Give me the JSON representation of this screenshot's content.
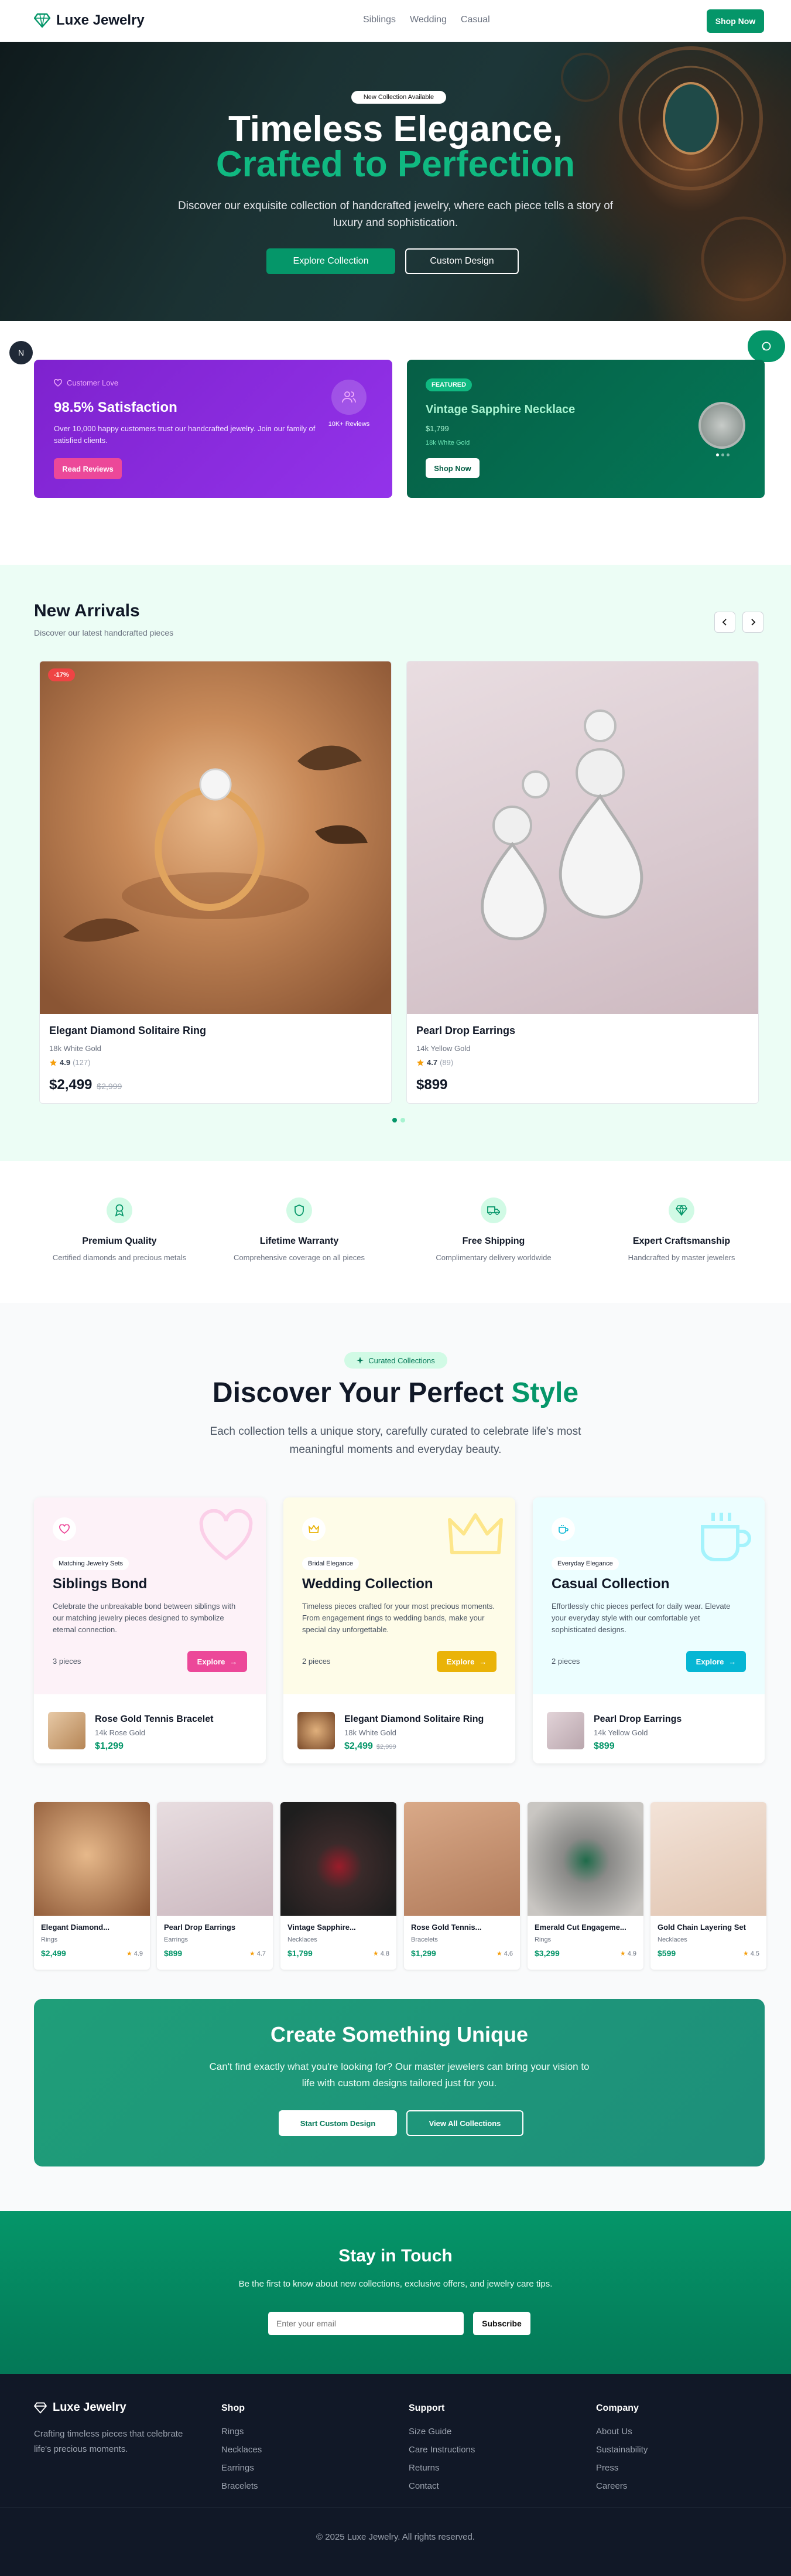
{
  "header": {
    "brand": "Luxe Jewelry",
    "nav": [
      "Siblings",
      "Wedding",
      "Casual"
    ],
    "shop_button": "Shop Now"
  },
  "hero": {
    "badge": "New Collection Available",
    "title_line1": "Timeless Elegance,",
    "title_line2": "Crafted to Perfection",
    "subtitle": "Discover our exquisite collection of handcrafted jewelry, where each piece tells a story of luxury and sophistication.",
    "primary_button": "Explore Collection",
    "secondary_button": "Custom Design"
  },
  "floating": {
    "left_avatar": "N"
  },
  "promo": {
    "left": {
      "eyebrow": "Customer Love",
      "title": "98.5% Satisfaction",
      "text": "Over 10,000 happy customers trust our handcrafted jewelry. Join our family of satisfied clients.",
      "button": "Read Reviews",
      "stat": "10K+ Reviews"
    },
    "right": {
      "badge": "FEATURED",
      "title": "Vintage Sapphire Necklace",
      "price": "$1,799",
      "material": "18k White Gold",
      "button": "Shop Now"
    }
  },
  "arrivals": {
    "title": "New Arrivals",
    "subtitle": "Discover our latest handcrafted pieces",
    "products": [
      {
        "discount": "-17%",
        "name": "Elegant Diamond Solitaire Ring",
        "material": "18k White Gold",
        "rating": "4.9",
        "reviews": "(127)",
        "price": "$2,499",
        "old_price": "$2,999"
      },
      {
        "name": "Pearl Drop Earrings",
        "material": "14k Yellow Gold",
        "rating": "4.7",
        "reviews": "(89)",
        "price": "$899"
      }
    ]
  },
  "features": [
    {
      "title": "Premium Quality",
      "desc": "Certified diamonds and precious metals"
    },
    {
      "title": "Lifetime Warranty",
      "desc": "Comprehensive coverage on all pieces"
    },
    {
      "title": "Free Shipping",
      "desc": "Complimentary delivery worldwide"
    },
    {
      "title": "Expert Craftsmanship",
      "desc": "Handcrafted by master jewelers"
    }
  ],
  "collections": {
    "badge": "Curated Collections",
    "title_a": "Discover Your Perfect",
    "title_b": "Style",
    "subtitle": "Each collection tells a unique story, carefully curated to celebrate life's most meaningful moments and everyday beauty.",
    "cards": [
      {
        "badge": "Matching Jewelry Sets",
        "title": "Siblings Bond",
        "desc": "Celebrate the unbreakable bond between siblings with our matching jewelry pieces designed to symbolize eternal connection.",
        "pieces": "3 pieces",
        "button": "Explore",
        "item": "Rose Gold Tennis Bracelet",
        "item_material": "14k Rose Gold",
        "item_price": "$1,299",
        "item_old": "",
        "color": "#ec4899"
      },
      {
        "badge": "Bridal Elegance",
        "title": "Wedding Collection",
        "desc": "Timeless pieces crafted for your most precious moments. From engagement rings to wedding bands, make your special day unforgettable.",
        "pieces": "2 pieces",
        "button": "Explore",
        "item": "Elegant Diamond Solitaire Ring",
        "item_material": "18k White Gold",
        "item_price": "$2,499",
        "item_old": "$2,999",
        "color": "#eab308"
      },
      {
        "badge": "Everyday Elegance",
        "title": "Casual Collection",
        "desc": "Effortlessly chic pieces perfect for daily wear. Elevate your everyday style with our comfortable yet sophisticated designs.",
        "pieces": "2 pieces",
        "button": "Explore",
        "item": "Pearl Drop Earrings",
        "item_material": "14k Yellow Gold",
        "item_price": "$899",
        "item_old": "",
        "color": "#06b6d4"
      }
    ],
    "grid": [
      {
        "name": "Elegant Diamond...",
        "cat": "Rings",
        "price": "$2,499",
        "rating": "4.9"
      },
      {
        "name": "Pearl Drop Earrings",
        "cat": "Earrings",
        "price": "$899",
        "rating": "4.7"
      },
      {
        "name": "Vintage Sapphire...",
        "cat": "Necklaces",
        "price": "$1,799",
        "rating": "4.8"
      },
      {
        "name": "Rose Gold Tennis...",
        "cat": "Bracelets",
        "price": "$1,299",
        "rating": "4.6"
      },
      {
        "name": "Emerald Cut Engageme...",
        "cat": "Rings",
        "price": "$3,299",
        "rating": "4.9"
      },
      {
        "name": "Gold Chain Layering Set",
        "cat": "Necklaces",
        "price": "$599",
        "rating": "4.5"
      }
    ]
  },
  "cta": {
    "title": "Create Something Unique",
    "text": "Can't find exactly what you're looking for? Our master jewelers can bring your vision to life with custom designs tailored just for you.",
    "primary": "Start Custom Design",
    "secondary": "View All Collections"
  },
  "newsletter": {
    "title": "Stay in Touch",
    "text": "Be the first to know about new collections, exclusive offers, and jewelry care tips.",
    "placeholder": "Enter your email",
    "button": "Subscribe"
  },
  "footer": {
    "brand": "Luxe Jewelry",
    "tagline": "Crafting timeless pieces that celebrate life's precious moments.",
    "shop": {
      "title": "Shop",
      "links": [
        "Rings",
        "Necklaces",
        "Earrings",
        "Bracelets"
      ]
    },
    "support": {
      "title": "Support",
      "links": [
        "Size Guide",
        "Care Instructions",
        "Returns",
        "Contact"
      ]
    },
    "company": {
      "title": "Company",
      "links": [
        "About Us",
        "Sustainability",
        "Press",
        "Careers"
      ]
    },
    "copyright": "© 2025 Luxe Jewelry. All rights reserved."
  },
  "colors": {
    "primary": "#059669",
    "dark": "#111827",
    "purple": "#7e22ce",
    "pink": "#ec4899",
    "amber": "#eab308",
    "cyan": "#06b6d4"
  }
}
